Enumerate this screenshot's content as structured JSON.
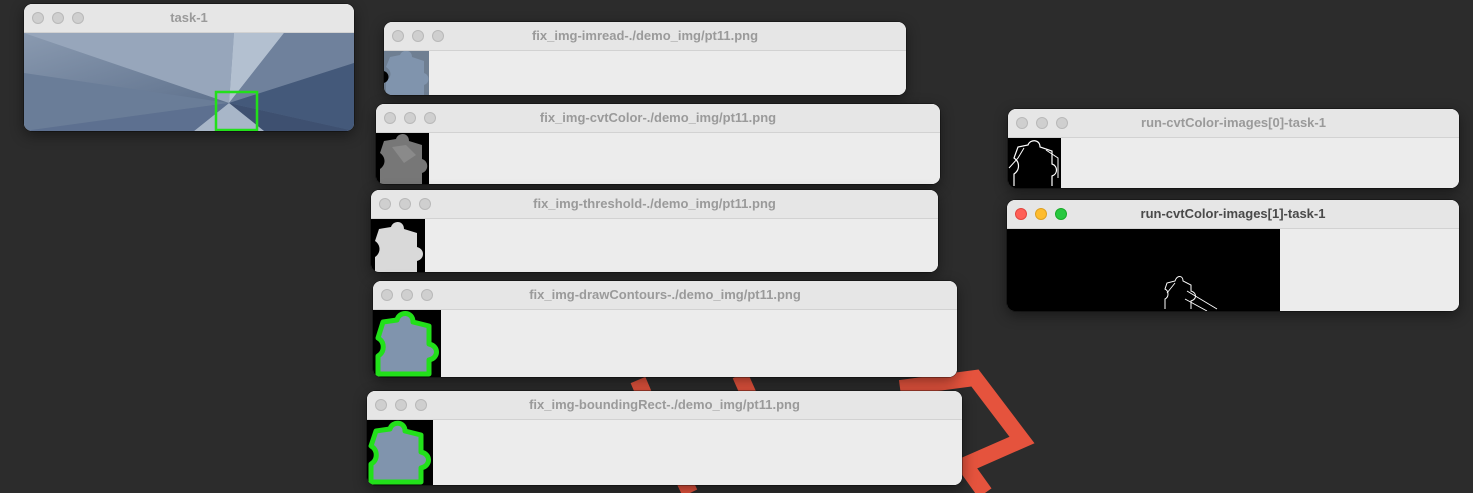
{
  "windows": {
    "task1": {
      "title": "task-1"
    },
    "imread": {
      "title": "fix_img-imread-./demo_img/pt11.png"
    },
    "cvtcolor": {
      "title": "fix_img-cvtColor-./demo_img/pt11.png"
    },
    "threshold": {
      "title": "fix_img-threshold-./demo_img/pt11.png"
    },
    "drawcontours": {
      "title": "fix_img-drawContours-./demo_img/pt11.png"
    },
    "boundingrect": {
      "title": "fix_img-boundingRect-./demo_img/pt11.png"
    },
    "run0": {
      "title": "run-cvtColor-images[0]-task-1"
    },
    "run1": {
      "title": "run-cvtColor-images[1]-task-1"
    }
  },
  "colors": {
    "desktop_bg": "#2c2c2c",
    "wallpaper_accent": "#e5533d",
    "contour_green": "#22e01a",
    "puzzle_blue": "#7f92ab"
  },
  "icons": [
    "traffic-light-close-icon",
    "traffic-light-minimize-icon",
    "traffic-light-zoom-icon"
  ]
}
